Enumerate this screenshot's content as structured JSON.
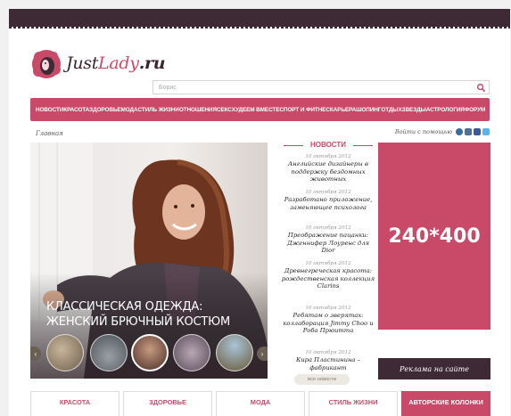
{
  "brand": {
    "name_part1": "Just",
    "name_part2": "Lady",
    "name_part3": ".ru",
    "accent_color": "#c94a68",
    "dark_color": "#3d2a35"
  },
  "search": {
    "placeholder": "Борис"
  },
  "nav": {
    "items": [
      "Новости",
      "Красота",
      "Здоровье",
      "Мода",
      "Стиль жизни",
      "Отношения",
      "Секс",
      "Худеем вместе",
      "Спорт и фитнес",
      "Карьера",
      "Шопинг",
      "Отдых",
      "Звезды",
      "Астрология",
      "Форум"
    ]
  },
  "breadcrumb": {
    "label": "Главная"
  },
  "login": {
    "label": "Войти с помощью",
    "icons": [
      "openid-icon",
      "vk-icon",
      "facebook-icon",
      "twitter-icon"
    ]
  },
  "slider": {
    "title": "Классическая одежда: женский брючный костюм",
    "thumb_count": 5,
    "active_index": 2
  },
  "news": {
    "header": "НОВОСТИ",
    "items": [
      {
        "date": "10 октября 2012",
        "title": "Английские дизайнеры в поддержку бездомных животных"
      },
      {
        "date": "10 октября 2012",
        "title": "Разработано приложение, заменяющее психолога"
      },
      {
        "date": "10 октября 2012",
        "title": "Преображение пацанки: Дженнифер Лоуренс для Dior"
      },
      {
        "date": "10 октября 2012",
        "title": "Древнегреческая красота: рождественская коллекция Clarins"
      },
      {
        "date": "10 октября 2012",
        "title": "Ребятам о зверятах: коллаборация Jimmy Choo и Роба Прюитта"
      },
      {
        "date": "10 октября 2012",
        "title": "Кира Пластинина – фабрикант"
      }
    ],
    "all_label": "все новости"
  },
  "ad": {
    "label": "240*400",
    "button_label": "Реклама на сайте"
  },
  "categories": [
    {
      "label": "КРАСОТА",
      "dark": false
    },
    {
      "label": "ЗДОРОВЬЕ",
      "dark": false
    },
    {
      "label": "МОДА",
      "dark": false
    },
    {
      "label": "СТИЛЬ ЖИЗНИ",
      "dark": false
    },
    {
      "label": "АВТОРСКИЕ КОЛОНКИ",
      "dark": true
    }
  ]
}
